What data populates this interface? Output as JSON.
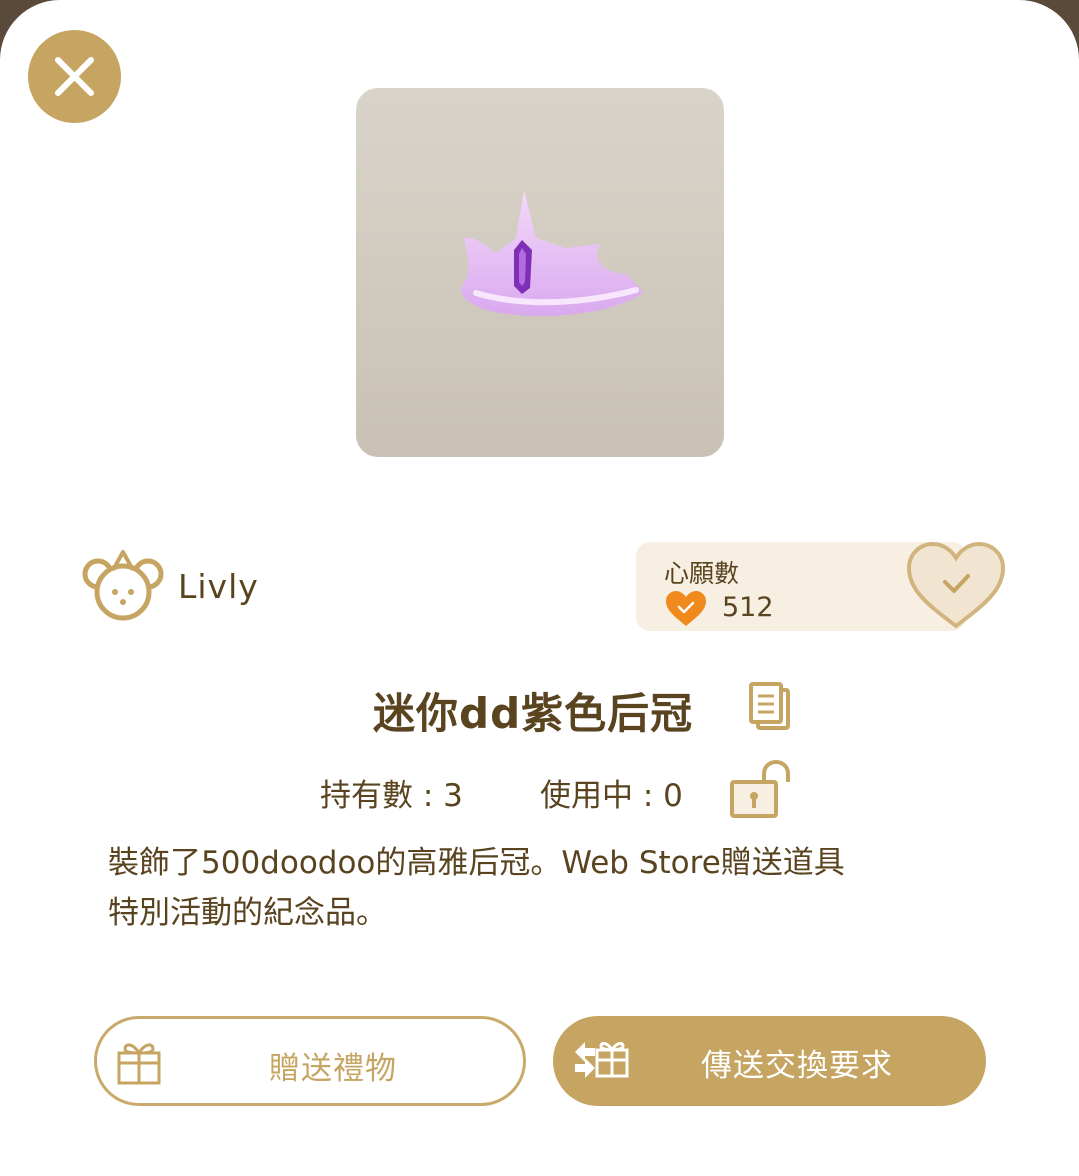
{
  "colors": {
    "accent": "#c6a461",
    "text": "#5a4420",
    "wish_bg": "#f6efe2",
    "heart_orange": "#f08a1c"
  },
  "header": {
    "close_icon": "close-icon"
  },
  "item": {
    "image_icon": "purple-tiara",
    "brand": "Livly",
    "name": "迷你dd紫色后冠",
    "owned_label": "持有數 : 3",
    "in_use_label": "使用中 : 0",
    "description_line1": "裝飾了500doodoo的高雅后冠。Web Store贈送道具",
    "description_line2": "特別活動的紀念品。"
  },
  "wish": {
    "label": "心願數",
    "count": "512"
  },
  "actions": {
    "gift_label": "贈送禮物",
    "trade_label": "傳送交換要求"
  }
}
